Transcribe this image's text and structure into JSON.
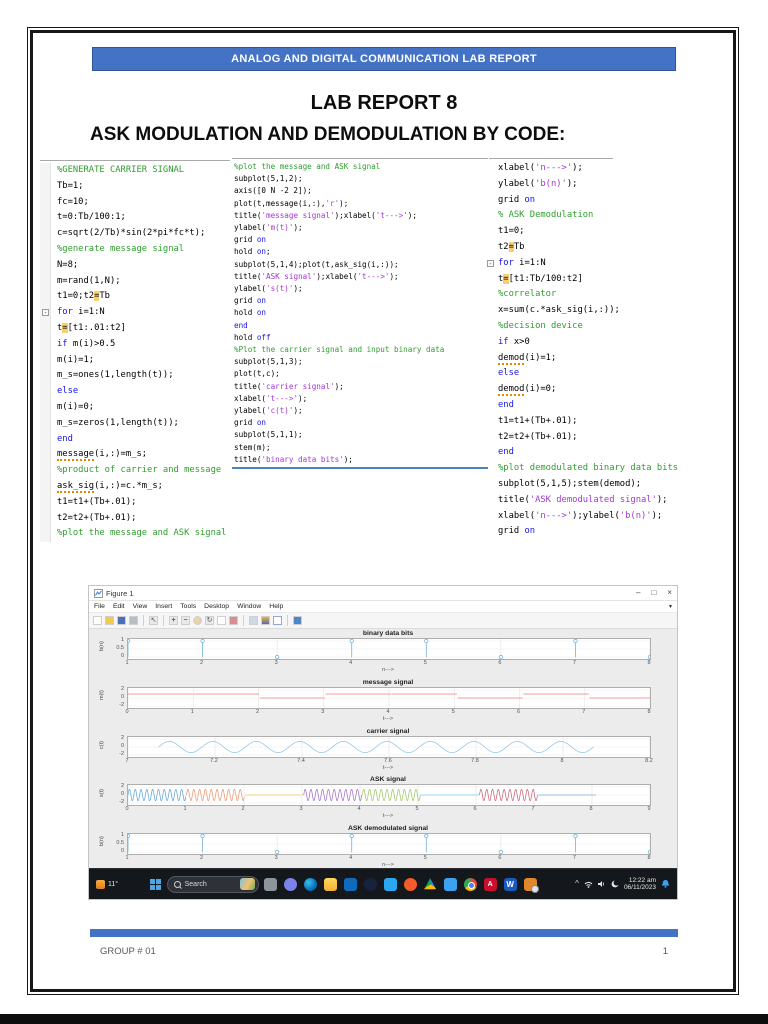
{
  "page": {
    "banner": "ANALOG AND DIGITAL COMMUNICATION LAB REPORT",
    "title": "LAB REPORT 8",
    "subtitle": "ASK MODULATION AND DEMODULATION BY CODE:",
    "footer_left": "GROUP # 01",
    "footer_page": "1"
  },
  "code": {
    "columns": [
      {
        "fold_lines": [
          9
        ],
        "lines": [
          [
            [
              "%GENERATE CARRIER SIGNAL",
              "c"
            ]
          ],
          [
            [
              "Tb=1;",
              "n"
            ]
          ],
          [
            [
              "fc=10;",
              "n"
            ]
          ],
          [
            [
              "t=0:Tb/100:1;",
              "n"
            ]
          ],
          [
            [
              "c=sqrt(2/Tb)*sin(2*pi*fc*t);",
              "n"
            ]
          ],
          [
            [
              "%generate message signal",
              "c"
            ]
          ],
          [
            [
              "N=8;",
              "n"
            ]
          ],
          [
            [
              "m=rand(1,N);",
              "n"
            ]
          ],
          [
            [
              "t1=0;t2",
              "n"
            ],
            [
              "=",
              "h"
            ],
            [
              "Tb",
              "n"
            ]
          ],
          [
            [
              "for",
              "k"
            ],
            [
              " i=1:N",
              "n"
            ]
          ],
          [
            [
              "t",
              "n"
            ],
            [
              "=",
              "h"
            ],
            [
              "[t1:.01:t2]",
              "n"
            ]
          ],
          [
            [
              "if",
              "k"
            ],
            [
              " m(i)>0.5",
              "n"
            ]
          ],
          [
            [
              "m(i)=1;",
              "n"
            ]
          ],
          [
            [
              "m_s=ones(1,length(t));",
              "n"
            ]
          ],
          [
            [
              "else",
              "k"
            ]
          ],
          [
            [
              "m(i)=0;",
              "n"
            ]
          ],
          [
            [
              "m_s=zeros(1,length(t));",
              "n"
            ]
          ],
          [
            [
              "end",
              "k"
            ]
          ],
          [
            [
              "message",
              "u"
            ],
            [
              "(i,:)=m_s;",
              "n"
            ]
          ],
          [
            [
              "%product of carrier and message",
              "c"
            ]
          ],
          [
            [
              "ask_sig",
              "u"
            ],
            [
              "(i,:)=c.*m_s;",
              "n"
            ]
          ],
          [
            [
              "t1=t1+(Tb+.01);",
              "n"
            ]
          ],
          [
            [
              "t2=t2+(Tb+.01);",
              "n"
            ]
          ],
          [
            [
              "%plot the message and ASK signal",
              "c"
            ]
          ]
        ]
      },
      {
        "fold_lines": [],
        "lines": [
          [
            [
              "%plot the message and ASK signal",
              "c"
            ]
          ],
          [
            [
              "subplot(5,1,2);",
              "n"
            ]
          ],
          [
            [
              "axis([0 N -2 2]);",
              "n"
            ]
          ],
          [
            [
              "plot(t,message(i,:),",
              "n"
            ],
            [
              "'r'",
              "s"
            ],
            [
              ");",
              "n"
            ]
          ],
          [
            [
              "title(",
              "n"
            ],
            [
              "'message signal'",
              "s"
            ],
            [
              ");xlabel(",
              "n"
            ],
            [
              "'t--->'",
              "s"
            ],
            [
              ");",
              "n"
            ]
          ],
          [
            [
              "ylabel(",
              "n"
            ],
            [
              "'m(t)'",
              "s"
            ],
            [
              ");",
              "n"
            ]
          ],
          [
            [
              "grid ",
              "n"
            ],
            [
              "on",
              "k"
            ]
          ],
          [
            [
              "hold ",
              "n"
            ],
            [
              "on",
              "k"
            ],
            [
              ";",
              "n"
            ]
          ],
          [
            [
              "subplot(5,1,4);plot(t,ask_sig(i,:));",
              "n"
            ]
          ],
          [
            [
              "title(",
              "n"
            ],
            [
              "'ASK signal'",
              "s"
            ],
            [
              ");xlabel(",
              "n"
            ],
            [
              "'t--->'",
              "s"
            ],
            [
              ");",
              "n"
            ]
          ],
          [
            [
              "ylabel(",
              "n"
            ],
            [
              "'s(t)'",
              "s"
            ],
            [
              ");",
              "n"
            ]
          ],
          [
            [
              "grid ",
              "n"
            ],
            [
              "on",
              "k"
            ]
          ],
          [
            [
              "hold ",
              "n"
            ],
            [
              "on",
              "k"
            ]
          ],
          [
            [
              "end",
              "k"
            ]
          ],
          [
            [
              "hold ",
              "n"
            ],
            [
              "off",
              "k"
            ]
          ],
          [
            [
              "%Plot the carrier signal and input binary data",
              "c"
            ]
          ],
          [
            [
              "subplot(5,1,3);",
              "n"
            ]
          ],
          [
            [
              "plot(t,c);",
              "n"
            ]
          ],
          [
            [
              "title(",
              "n"
            ],
            [
              "'carrier signal'",
              "s"
            ],
            [
              ");",
              "n"
            ]
          ],
          [
            [
              "xlabel(",
              "n"
            ],
            [
              "'t--->'",
              "s"
            ],
            [
              ");",
              "n"
            ]
          ],
          [
            [
              "ylabel(",
              "n"
            ],
            [
              "'c(t)'",
              "s"
            ],
            [
              ");",
              "n"
            ]
          ],
          [
            [
              "grid ",
              "n"
            ],
            [
              "on",
              "k"
            ]
          ],
          [
            [
              "subplot(5,1,1);",
              "n"
            ]
          ],
          [
            [
              "stem(m);",
              "n"
            ]
          ],
          [
            [
              "title(",
              "n"
            ],
            [
              "'binary data bits'",
              "s"
            ],
            [
              ");",
              "n"
            ]
          ]
        ]
      },
      {
        "fold_lines": [
          6
        ],
        "lines": [
          [
            [
              "xlabel(",
              "n"
            ],
            [
              "'n--->'",
              "s"
            ],
            [
              ");",
              "n"
            ]
          ],
          [
            [
              "ylabel(",
              "n"
            ],
            [
              "'b(n)'",
              "s"
            ],
            [
              ");",
              "n"
            ]
          ],
          [
            [
              "grid ",
              "n"
            ],
            [
              "on",
              "k"
            ]
          ],
          [
            [
              "% ASK Demodulation",
              "c"
            ]
          ],
          [
            [
              "t1=0;",
              "n"
            ]
          ],
          [
            [
              "t2",
              "n"
            ],
            [
              "=",
              "h"
            ],
            [
              "Tb",
              "n"
            ]
          ],
          [
            [
              "for",
              "k"
            ],
            [
              " i=1:N",
              "n"
            ]
          ],
          [
            [
              "t",
              "n"
            ],
            [
              "=",
              "h"
            ],
            [
              "[t1:Tb/100:t2]",
              "n"
            ]
          ],
          [
            [
              "%correlator",
              "c"
            ]
          ],
          [
            [
              "x=sum(c.*ask_sig(i,:));",
              "n"
            ]
          ],
          [
            [
              "%decision device",
              "c"
            ]
          ],
          [
            [
              "if",
              "k"
            ],
            [
              " x>0",
              "n"
            ]
          ],
          [
            [
              "demod",
              "u"
            ],
            [
              "(i)=1;",
              "n"
            ]
          ],
          [
            [
              "else",
              "k"
            ]
          ],
          [
            [
              "demod",
              "u"
            ],
            [
              "(i)=0;",
              "n"
            ]
          ],
          [
            [
              "end",
              "k"
            ]
          ],
          [
            [
              "t1=t1+(Tb+.01);",
              "n"
            ]
          ],
          [
            [
              "t2=t2+(Tb+.01);",
              "n"
            ]
          ],
          [
            [
              "end",
              "k"
            ]
          ],
          [
            [
              "%plot demodulated binary data bits",
              "c"
            ]
          ],
          [
            [
              "subplot(5,1,5);stem(demod);",
              "n"
            ]
          ],
          [
            [
              "title(",
              "n"
            ],
            [
              "'ASK demodulated signal'",
              "s"
            ],
            [
              ");",
              "n"
            ]
          ],
          [
            [
              "xlabel(",
              "n"
            ],
            [
              "'n--->'",
              "s"
            ],
            [
              ");ylabel(",
              "n"
            ],
            [
              "'b(n)'",
              "s"
            ],
            [
              ");",
              "n"
            ]
          ],
          [
            [
              "grid ",
              "n"
            ],
            [
              "on",
              "k"
            ]
          ]
        ]
      }
    ]
  },
  "figure_window": {
    "title": "Figure 1",
    "menu": [
      "File",
      "Edit",
      "View",
      "Insert",
      "Tools",
      "Desktop",
      "Window",
      "Help"
    ],
    "toolbar": [
      "new-figure",
      "open-file",
      "save-figure",
      "print-figure",
      "sep",
      "edit-plot",
      "sep",
      "zoom-in",
      "zoom-out",
      "pan",
      "rotate-3d",
      "data-cursor",
      "brush-data",
      "sep",
      "link-plots",
      "insert-colorbar",
      "insert-legend",
      "sep",
      "dock-figure"
    ],
    "window_controls": [
      {
        "name": "minimize",
        "glyph": "–"
      },
      {
        "name": "restore",
        "glyph": "□"
      },
      {
        "name": "close",
        "glyph": "×"
      }
    ]
  },
  "chart_data": [
    {
      "id": "binary-data-bits",
      "type": "stem",
      "title": "binary data bits",
      "xlabel": "n--->",
      "ylabel": "b(n)",
      "xlim": [
        1,
        8
      ],
      "xticks": [
        "1",
        "2",
        "3",
        "4",
        "5",
        "6",
        "7",
        "8"
      ],
      "ylim": [
        0,
        1
      ],
      "yticks": [
        "0",
        "0.5",
        "1"
      ],
      "values": [
        1,
        1,
        0,
        1,
        1,
        0,
        1,
        0
      ],
      "color": "#74b4da",
      "grid": true
    },
    {
      "id": "message-signal",
      "type": "step",
      "title": "message signal",
      "xlabel": "t--->",
      "ylabel": "m(t)",
      "xlim": [
        0,
        8
      ],
      "xticks": [
        "0",
        "1",
        "2",
        "3",
        "4",
        "5",
        "6",
        "7",
        "8"
      ],
      "ylim": [
        -2,
        2
      ],
      "yticks": [
        "-2",
        "0",
        "2"
      ],
      "bits": [
        1,
        1,
        0,
        1,
        1,
        0,
        1,
        0
      ],
      "bit_width": 1.01,
      "color": "#f09b9b",
      "grid": true
    },
    {
      "id": "carrier-signal",
      "type": "sine",
      "title": "carrier signal",
      "xlabel": "t--->",
      "ylabel": "c(t)",
      "xlim": [
        7,
        8.2
      ],
      "xticks": [
        "7",
        "7.2",
        "7.4",
        "7.6",
        "7.8",
        "8",
        "8.2"
      ],
      "ylim": [
        -2,
        2
      ],
      "yticks": [
        "-2",
        "0",
        "2"
      ],
      "wave": {
        "start": 7.07,
        "end": 8.07,
        "freq": 10,
        "amp": 1.41
      },
      "color": "#88c4e8",
      "grid": true
    },
    {
      "id": "ask-signal",
      "type": "ask",
      "title": "ASK signal",
      "xlabel": "t--->",
      "ylabel": "s(t)",
      "xlim": [
        0,
        9
      ],
      "xticks": [
        "0",
        "1",
        "2",
        "3",
        "4",
        "5",
        "6",
        "7",
        "8",
        "9"
      ],
      "ylim": [
        -2,
        2
      ],
      "yticks": [
        "-2",
        "0",
        "2"
      ],
      "bits": [
        1,
        1,
        0,
        1,
        1,
        0,
        1,
        0
      ],
      "bit_width": 1.01,
      "freq": 10,
      "amp": 1.41,
      "colors": [
        "#5aa2d4",
        "#e8936c",
        "#ecc95f",
        "#a06ac4",
        "#9cc45e",
        "#6fd0f0",
        "#c75e74",
        "#7fb0dc"
      ],
      "grid": true
    },
    {
      "id": "ask-demodulated-signal",
      "type": "stem",
      "title": "ASK demodulated signal",
      "xlabel": "n--->",
      "ylabel": "b(n)",
      "xlim": [
        1,
        8
      ],
      "xticks": [
        "1",
        "2",
        "3",
        "4",
        "5",
        "6",
        "7",
        "8"
      ],
      "ylim": [
        0,
        1
      ],
      "yticks": [
        "0",
        "0.5",
        "1"
      ],
      "values": [
        1,
        1,
        0,
        1,
        1,
        0,
        1,
        0
      ],
      "color": "#74b4da",
      "grid": true
    }
  ],
  "taskbar": {
    "weather_temp": "11°",
    "search_label": "Search",
    "time": "12:22 am",
    "date": "06/11/2023",
    "icons": [
      {
        "name": "task-view"
      },
      {
        "name": "chat"
      },
      {
        "name": "edge"
      },
      {
        "name": "file-explorer"
      },
      {
        "name": "microsoft-store"
      },
      {
        "name": "steam"
      },
      {
        "name": "vscode"
      },
      {
        "name": "brave"
      },
      {
        "name": "google-drive"
      },
      {
        "name": "mail"
      },
      {
        "name": "chrome"
      },
      {
        "name": "adobe-reader",
        "glyph": "A"
      },
      {
        "name": "word",
        "glyph": "W"
      },
      {
        "name": "pending-app"
      }
    ]
  }
}
